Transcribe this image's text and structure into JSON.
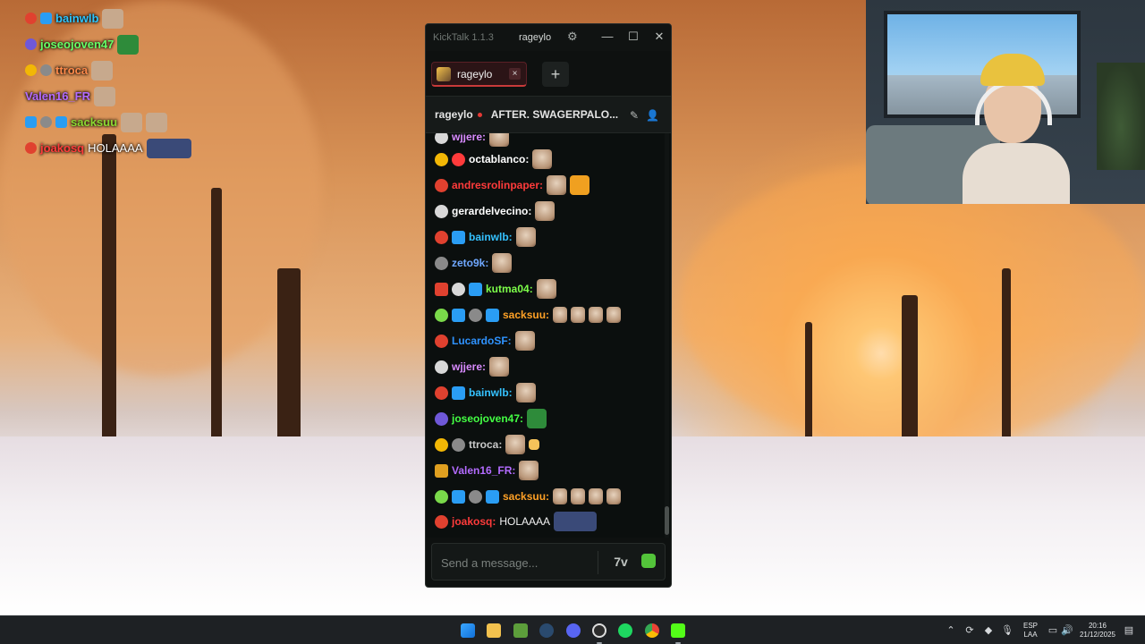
{
  "overlay_chat": [
    {
      "username": "bainwlb",
      "message": "",
      "color": "#2ec5ff"
    },
    {
      "username": "joseojoven47",
      "message": "",
      "color": "#66ff66"
    },
    {
      "username": "ttroca",
      "message": "",
      "color": "#ff8a4a"
    },
    {
      "username": "Valen16_FR",
      "message": "",
      "color": "#b36bff"
    },
    {
      "username": "sacksuu",
      "message": "",
      "color": "#8cd932"
    },
    {
      "username": "joakosq",
      "message": "HOLAAAA",
      "color": "#ff3b3b"
    }
  ],
  "window": {
    "app_title": "KickTalk 1.1.3",
    "channel_name": "rageylo",
    "settings_icon": "gear-icon",
    "minimize_icon": "minimize-icon",
    "maximize_icon": "maximize-icon",
    "close_icon": "close-icon"
  },
  "tabs": {
    "items": [
      {
        "label": "rageylo",
        "active": true
      }
    ],
    "add_icon": "plus-icon",
    "close_label": "×",
    "add_label": "+"
  },
  "stream": {
    "username": "rageylo",
    "title": "AFTER. SWAGERPALO...",
    "live": true,
    "pin_icon": "pin-icon",
    "user_icon": "user-icon"
  },
  "chat_messages": [
    {
      "username": "wjjere:",
      "color": "#d98bff",
      "text": ""
    },
    {
      "username": "octablanco:",
      "color": "#ffffff",
      "text": ""
    },
    {
      "username": "andresrolinpaper:",
      "color": "#ff3b3b",
      "text": ""
    },
    {
      "username": "gerardelvecino:",
      "color": "#ffffff",
      "text": ""
    },
    {
      "username": "bainwlb:",
      "color": "#35c2ff",
      "text": ""
    },
    {
      "username": "zeto9k:",
      "color": "#6fa8ff",
      "text": ""
    },
    {
      "username": "kutma04:",
      "color": "#7dff4a",
      "text": ""
    },
    {
      "username": "sacksuu:",
      "color": "#ffa126",
      "text": ""
    },
    {
      "username": "LucardoSF:",
      "color": "#2f93ff",
      "text": ""
    },
    {
      "username": "wjjere:",
      "color": "#d98bff",
      "text": ""
    },
    {
      "username": "bainwlb:",
      "color": "#35c2ff",
      "text": ""
    },
    {
      "username": "joseojoven47:",
      "color": "#44ff44",
      "text": ""
    },
    {
      "username": "ttroca:",
      "color": "#c9c9c9",
      "text": ""
    },
    {
      "username": "Valen16_FR:",
      "color": "#b36bff",
      "text": ""
    },
    {
      "username": "sacksuu:",
      "color": "#ffa126",
      "text": ""
    },
    {
      "username": "joakosq:",
      "color": "#ff3b3b",
      "text": "HOLAAAA"
    }
  ],
  "input": {
    "placeholder": "Send a message...",
    "emote_menu_label": "7v",
    "emote_menu_icon": "7tv-icon",
    "kick_emote_icon": "kick-emote-icon"
  },
  "taskbar": {
    "apps": [
      "windows-start-icon",
      "file-explorer-icon",
      "minecraft-icon",
      "steam-icon",
      "discord-icon",
      "obs-icon",
      "spotify-icon",
      "chrome-icon",
      "kick-icon"
    ],
    "tray_icons": [
      "chevron-up-icon",
      "sync-icon",
      "defender-icon",
      "microphone-icon",
      "language-icon",
      "network-icon",
      "volume-icon"
    ],
    "language": "ESP",
    "keyboard": "LAA",
    "time": "20:16",
    "date": "21/12/2025",
    "notification_icon": "notification-icon"
  },
  "colors": {
    "window_bg": "#0e1110",
    "tab_accent": "#c83a3a",
    "kick_green": "#53fc18",
    "live_dot": "#e53935"
  }
}
